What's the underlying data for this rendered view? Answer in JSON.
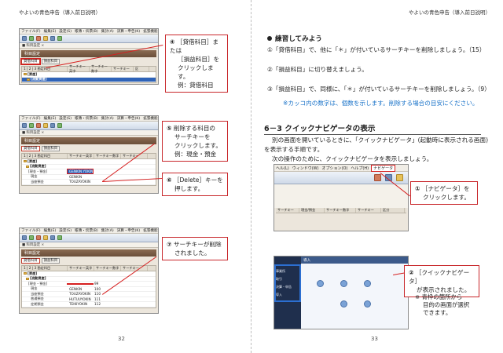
{
  "left_page": {
    "header": "やよいの青色申告（導入前日説明）",
    "page_number": "32",
    "shot1": {
      "menu": [
        "ファイル(F)",
        "編集(E)",
        "設定(S)",
        "帳簿・伝票(B)",
        "集計(A)",
        "決算・申告(K)",
        "拡張機能"
      ],
      "tab": "■ 科目設定  ×",
      "title": "科目設定",
      "subtab_a": "貸借科目",
      "subtab_b": "損益科目",
      "headers": [
        "1 | 2 | 3  勘定科目",
        "サーチキー英字",
        "サーチキー数字",
        "サーチキー",
        "区"
      ],
      "rows": [
        "[資産]",
        "[流動資産]"
      ]
    },
    "callout1": {
      "num": "④",
      "lines": [
        "［貸借科目］または",
        "［損益科目］を",
        "クリックします。",
        "例：貸借科目"
      ]
    },
    "shot2": {
      "menu": [
        "ファイル(F)",
        "編集(E)",
        "設定(S)",
        "帳簿・伝票(B)",
        "集計(A)",
        "決算・申告(K)",
        "拡張機能"
      ],
      "tab": "■ 科目設定  ×",
      "title": "科目設定",
      "subtab_a": "貸借科目",
      "subtab_b": "損益科目",
      "headers": [
        "1 | 2 | 3  勘定科目",
        "サーチキー英字",
        "サーチキー数字",
        "サーチキー"
      ],
      "rows": [
        {
          "name": "[資産]",
          "key": ""
        },
        {
          "name": "[流動資産]",
          "key": ""
        },
        {
          "name": "[現金・預金]",
          "key": "GENKIN.YOKIN"
        },
        {
          "name": "現金",
          "key": "GENKIN"
        },
        {
          "name": "当座預金",
          "key": "TOUZAYOKIN"
        }
      ]
    },
    "callout2": {
      "num": "⑤",
      "lines": [
        "削除する科目の",
        "サーチキーを",
        "クリックします。",
        "例：現金・預金"
      ]
    },
    "callout3": {
      "num": "⑥",
      "lines": [
        "［Delete］キーを",
        "押します。"
      ]
    },
    "shot3": {
      "menu": [
        "ファイル(F)",
        "編集(E)",
        "設定(S)",
        "帳簿・伝票(B)",
        "集計(A)",
        "決算・申告(K)",
        "拡張機能"
      ],
      "tab": "■ 科目設定  ×",
      "title": "科目設定",
      "subtab_a": "貸借科目",
      "subtab_b": "損益科目",
      "headers": [
        "1 | 2 | 3  勘定科目",
        "サーチキー英字",
        "サーチキー数字",
        "サーチキー"
      ],
      "rows": [
        {
          "name": "[資産]",
          "key": "",
          "num": ""
        },
        {
          "name": "[流動資産]",
          "key": "",
          "num": ""
        },
        {
          "name": "[現金・預金]",
          "key": "",
          "num": "99"
        },
        {
          "name": "現金",
          "key": "GENKIN",
          "num": "100"
        },
        {
          "name": "当座預金",
          "key": "TOUZAYOKIN",
          "num": "110"
        },
        {
          "name": "普通預金",
          "key": "HUTUUYOKIN",
          "num": "111"
        },
        {
          "name": "定期預金",
          "key": "TEIKIYOKIN",
          "num": "112"
        }
      ]
    },
    "callout4": {
      "num": "⑦",
      "lines": [
        "サーチキーが削除",
        "されました。"
      ]
    }
  },
  "right_page": {
    "header": "やよいの青色申告（導入前日説明）",
    "page_number": "33",
    "practice_title": "練習してみよう",
    "exercises": [
      "①「貸借科目」で、他に「＊」が付いているサーチキーを削除しましょう。（15）",
      "②「損益科目」に切り替えましょう。",
      "③「損益科目」で、同様に、「＊」が付いているサーチキーを削除しましょう。（9）"
    ],
    "exercise_note": "※カッコ内の数字は、個数を示します。削除する場合の目安にください。",
    "section_title": "6－3 クイックナビゲータの表示",
    "paragraph": [
      "別の画面を開いているときに、「クイックナビゲータ」(起動時に表示される画面)",
      "を表示する手順です。",
      "次の操作のために、クイックナビゲータを表示しましょう。"
    ],
    "shot4": {
      "menu": [
        "ヘル(L)",
        "ウィンドウ(W)",
        "オプション(O)",
        "ヘルプ(H)"
      ],
      "navi_button": "ナビゲータ",
      "headers": [
        "サーチキー",
        "現金/預金",
        "サーチキー数字",
        "サーチキー",
        "区分"
      ]
    },
    "callout5": {
      "num": "①",
      "lines": [
        "［ナビゲータ］を",
        "クリックします。"
      ]
    },
    "shot5": {
      "side_items": [
        "事業所",
        "取引",
        "決算・申告",
        "導入"
      ],
      "top": "導入"
    },
    "callout6": {
      "num": "②",
      "lines": [
        "［クイックナビゲータ］",
        "が表示されました。"
      ]
    },
    "note": [
      "※ 青枠の箇所から",
      "目的の画面が選択",
      "できます。"
    ]
  }
}
